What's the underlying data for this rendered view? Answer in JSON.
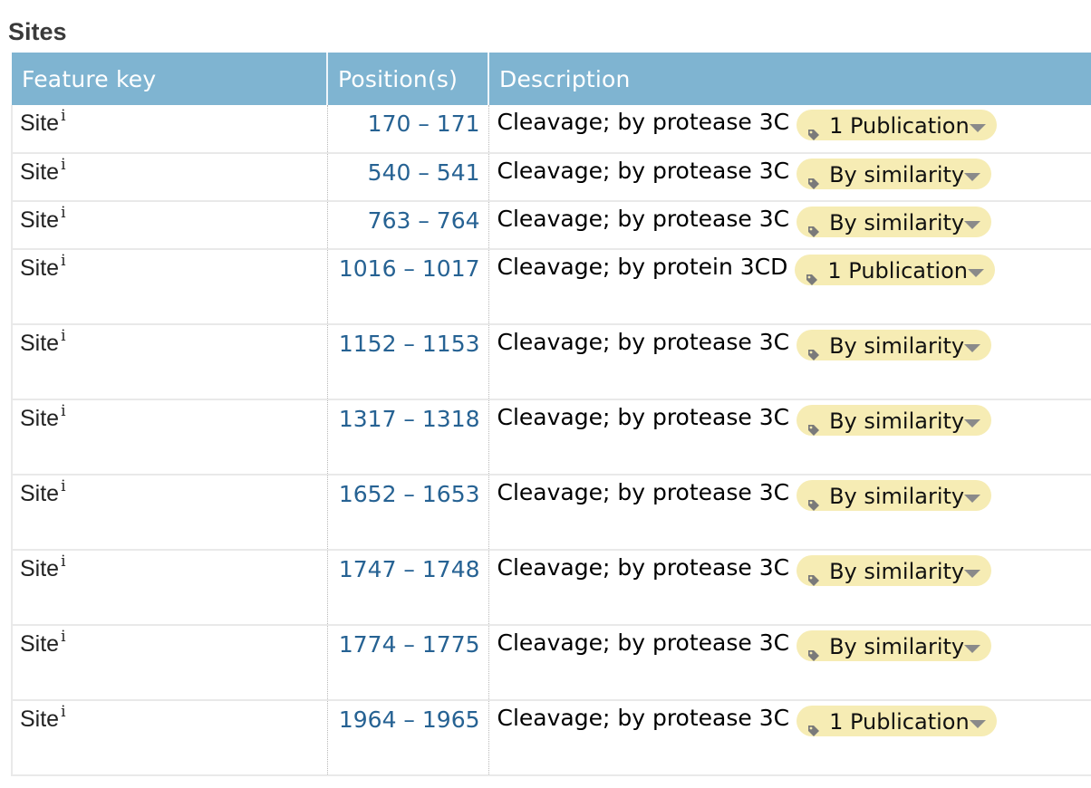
{
  "section": {
    "title": "Sites"
  },
  "table": {
    "headers": {
      "feature_key": "Feature key",
      "positions": "Position(s)",
      "description": "Description"
    },
    "rows": [
      {
        "key": "Site",
        "info": "i",
        "position": "170 – 171",
        "description": "Cleavage; by protease 3C",
        "evidence": "1 Publication",
        "evidence_icon": "tag-icon",
        "tall": false
      },
      {
        "key": "Site",
        "info": "i",
        "position": "540 – 541",
        "description": "Cleavage; by protease 3C",
        "evidence": "By similarity",
        "evidence_icon": "tag-icon",
        "tall": false
      },
      {
        "key": "Site",
        "info": "i",
        "position": "763 – 764",
        "description": "Cleavage; by protease 3C",
        "evidence": "By similarity",
        "evidence_icon": "tag-icon",
        "tall": false
      },
      {
        "key": "Site",
        "info": "i",
        "position": "1016 – 1017",
        "description": "Cleavage; by protein 3CD",
        "evidence": "1 Publication",
        "evidence_icon": "tag-icon",
        "tall": true
      },
      {
        "key": "Site",
        "info": "i",
        "position": "1152 – 1153",
        "description": "Cleavage; by protease 3C",
        "evidence": "By similarity",
        "evidence_icon": "tag-icon",
        "tall": true
      },
      {
        "key": "Site",
        "info": "i",
        "position": "1317 – 1318",
        "description": "Cleavage; by protease 3C",
        "evidence": "By similarity",
        "evidence_icon": "tag-icon",
        "tall": true
      },
      {
        "key": "Site",
        "info": "i",
        "position": "1652 – 1653",
        "description": "Cleavage; by protease 3C",
        "evidence": "By similarity",
        "evidence_icon": "tag-icon",
        "tall": true
      },
      {
        "key": "Site",
        "info": "i",
        "position": "1747 – 1748",
        "description": "Cleavage; by protease 3C",
        "evidence": "By similarity",
        "evidence_icon": "tag-icon",
        "tall": true
      },
      {
        "key": "Site",
        "info": "i",
        "position": "1774 – 1775",
        "description": "Cleavage; by protease 3C",
        "evidence": "By similarity",
        "evidence_icon": "tag-icon",
        "tall": true
      },
      {
        "key": "Site",
        "info": "i",
        "position": "1964 – 1965",
        "description": "Cleavage; by protease 3C",
        "evidence": "1 Publication",
        "evidence_icon": "tag-icon",
        "tall": true
      }
    ]
  },
  "colors": {
    "header_bg": "#7fb4d1",
    "link": "#266293",
    "evidence_bg": "#f6ecb4"
  }
}
